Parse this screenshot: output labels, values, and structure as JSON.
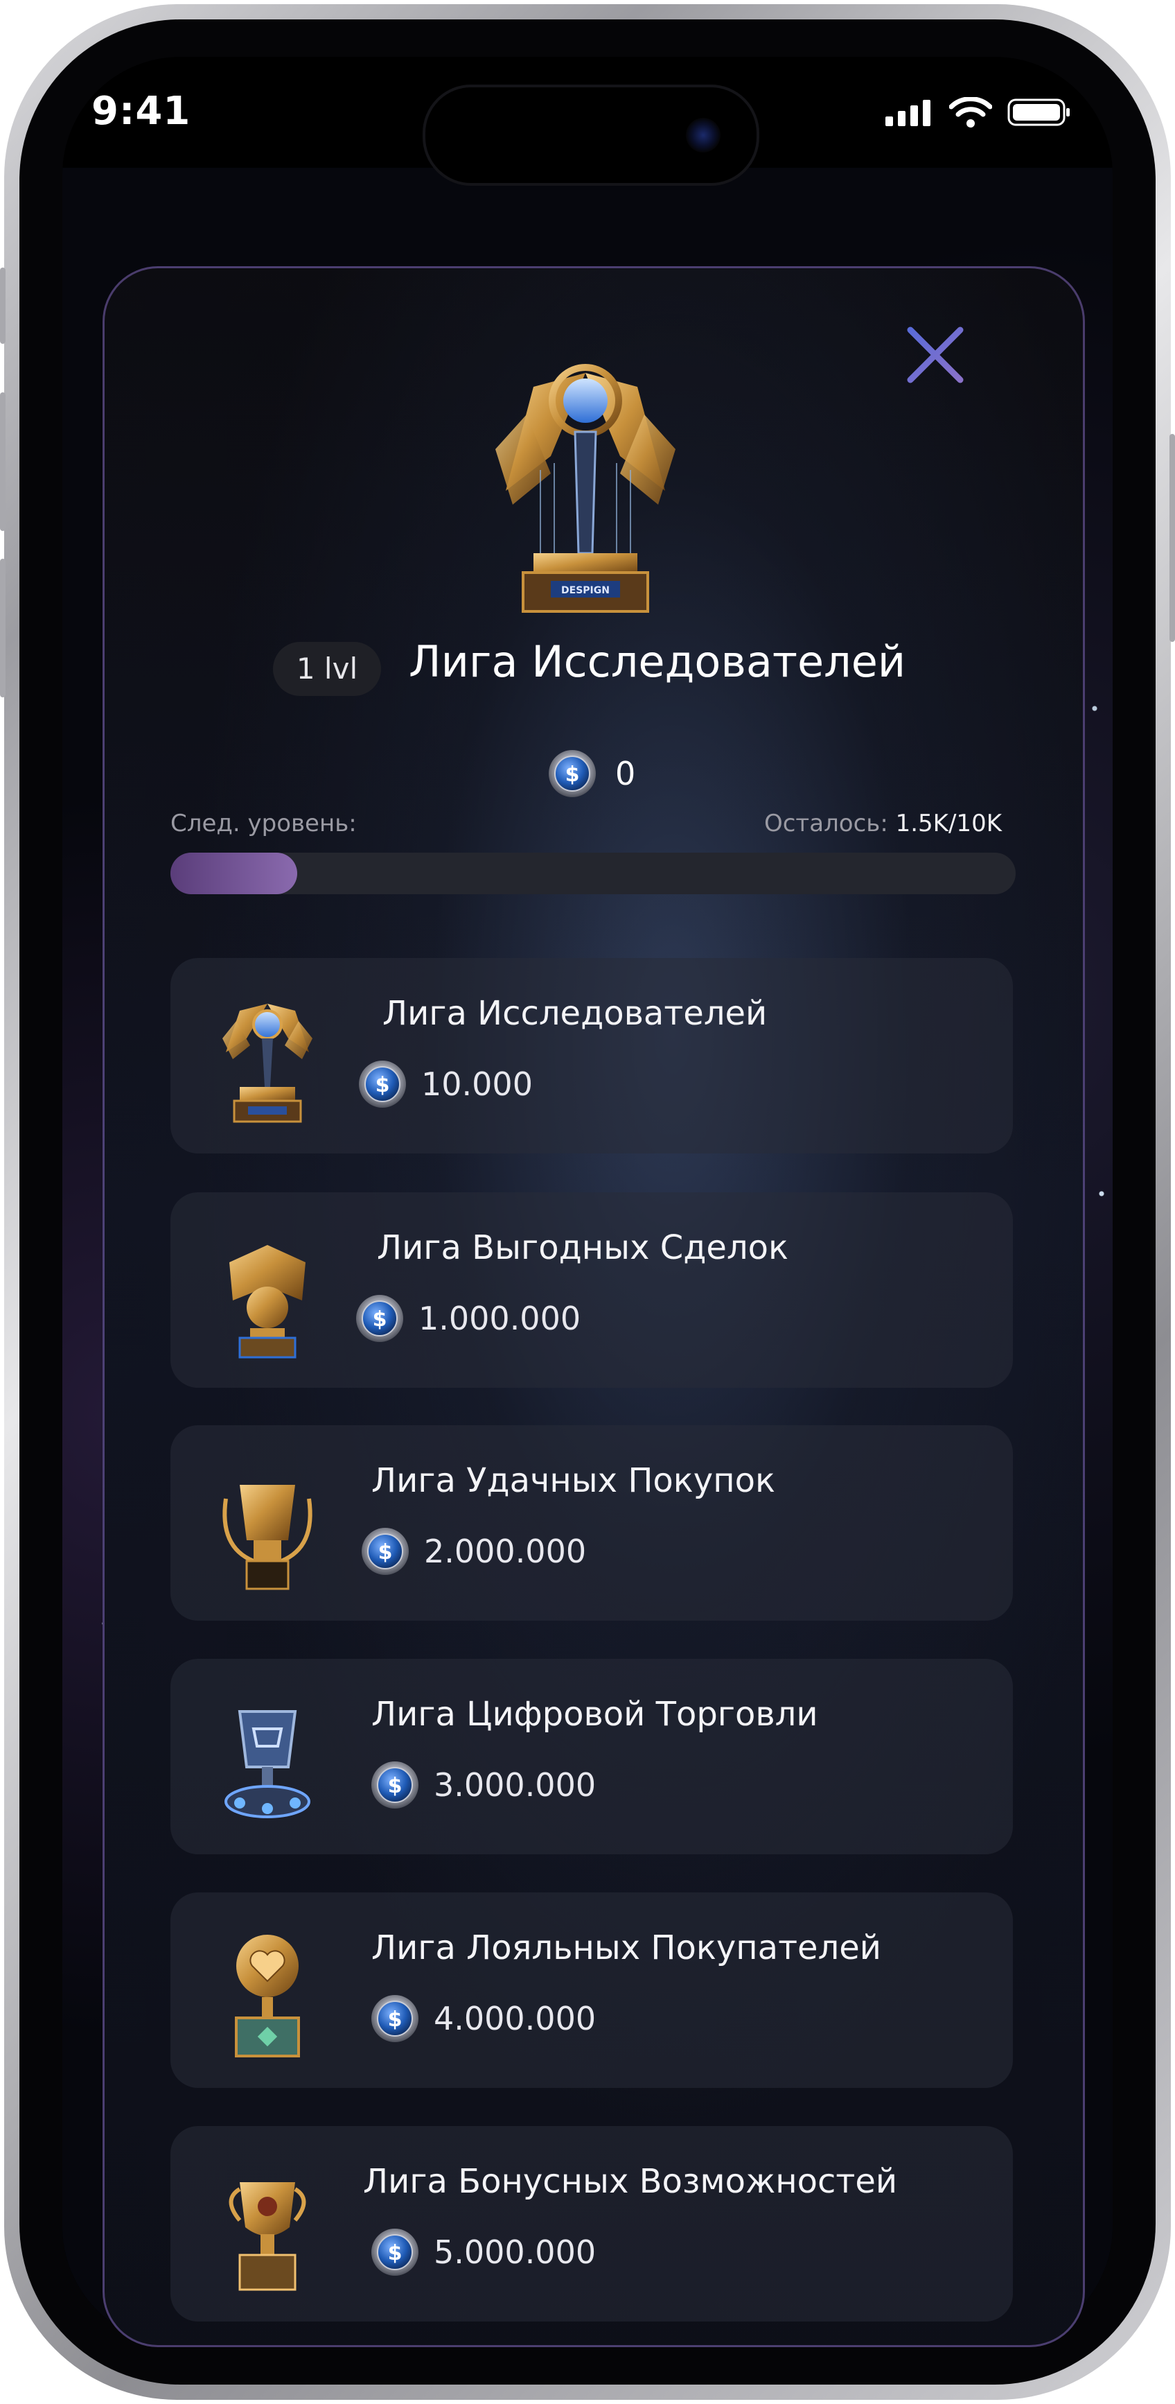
{
  "status_bar": {
    "time": "9:41"
  },
  "modal": {
    "level_badge": "1 lvl",
    "title": "Лига Исследователей",
    "balance": "0",
    "next_level_label": "След. уровень:",
    "remaining_label": "Осталось:",
    "remaining_value": "1.5K/10K",
    "progress_fraction": 0.15,
    "trophy_plate": "DESPIGN"
  },
  "leagues": [
    {
      "name": "Лига Исследователей",
      "price": "10.000",
      "icon": "explorer-trophy-icon"
    },
    {
      "name": "Лига Выгодных Сделок",
      "price": "1.000.000",
      "icon": "deal-trophy-icon"
    },
    {
      "name": "Лига Удачных Покупок",
      "price": "2.000.000",
      "icon": "purchase-trophy-icon"
    },
    {
      "name": "Лига Цифровой Торговли",
      "price": "3.000.000",
      "icon": "cart-trophy-icon"
    },
    {
      "name": "Лига Лояльных Покупателей",
      "price": "4.000.000",
      "icon": "heart-trophy-icon"
    },
    {
      "name": "Лига Бонусных Возможностей",
      "price": "5.000.000",
      "icon": "bonus-trophy-icon"
    }
  ],
  "colors": {
    "accent": "#8a6aae",
    "close": "#6f6ad8",
    "gold": "#c8913c"
  }
}
